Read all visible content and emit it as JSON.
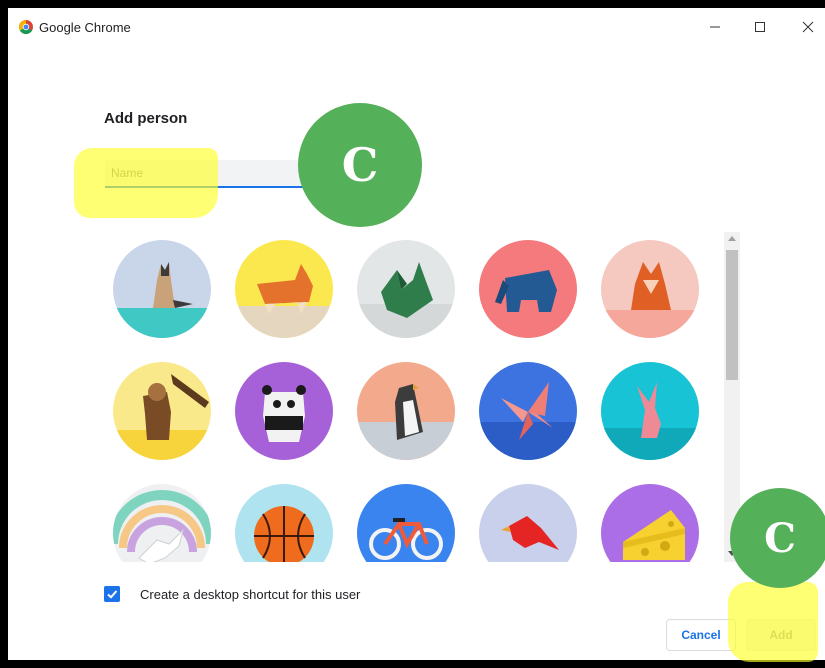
{
  "window": {
    "title": "Google Chrome"
  },
  "dialog": {
    "heading": "Add person",
    "name_input": {
      "placeholder": "Name",
      "value": ""
    },
    "shortcut_checkbox": {
      "label": "Create a desktop shortcut for this user",
      "checked": true
    },
    "buttons": {
      "cancel": "Cancel",
      "add": "Add"
    }
  },
  "annotations": {
    "badge_letter": "C"
  },
  "avatars": [
    "origami-cat",
    "origami-corgi",
    "origami-dragon",
    "origami-elephant",
    "origami-fox",
    "origami-monkey",
    "origami-panda",
    "origami-penguin",
    "origami-butterfly",
    "origami-rabbit",
    "origami-unicorn",
    "basketball",
    "bicycle",
    "bird",
    "cheese"
  ],
  "colors": {
    "accent": "#1a73e8",
    "badge": "#55b05a",
    "highlight": "#ffff28"
  }
}
